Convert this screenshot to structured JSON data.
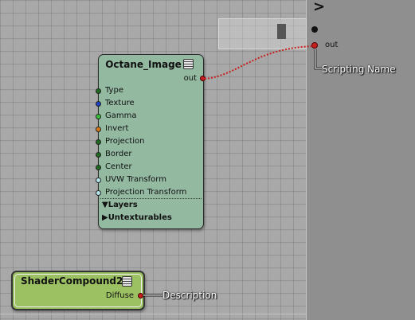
{
  "right_panel": {
    "expand_symbol": ">",
    "out_port_label": "out"
  },
  "octane_node": {
    "title": "Octane_Image",
    "output_label": "out",
    "inputs": [
      {
        "label": "Type",
        "port_color": "#1f6b22"
      },
      {
        "label": "Texture",
        "port_color": "#2040c8"
      },
      {
        "label": "Gamma",
        "port_color": "#36c23a"
      },
      {
        "label": "Invert",
        "port_color": "#d97a1a"
      },
      {
        "label": "Projection",
        "port_color": "#1f6b22"
      },
      {
        "label": "Border",
        "port_color": "#1f6b22"
      },
      {
        "label": "Center",
        "port_color": "#1f6b22"
      },
      {
        "label": "UVW Transform",
        "port_color": "#b7e3ea"
      },
      {
        "label": "Projection Transform",
        "port_color": "#b7e3ea"
      }
    ],
    "sections": [
      "▼Layers",
      "▶Untexturables"
    ],
    "background_color": "#93b9a1"
  },
  "shader_compound": {
    "title": "ShaderCompound2",
    "output_label": "Diffuse",
    "background_color": "#9cc162"
  },
  "callouts": {
    "scripting_name": "Scripting Name",
    "description": "Description"
  },
  "colors": {
    "connection": "#c81e1e",
    "port_red": "#c81e1e"
  }
}
